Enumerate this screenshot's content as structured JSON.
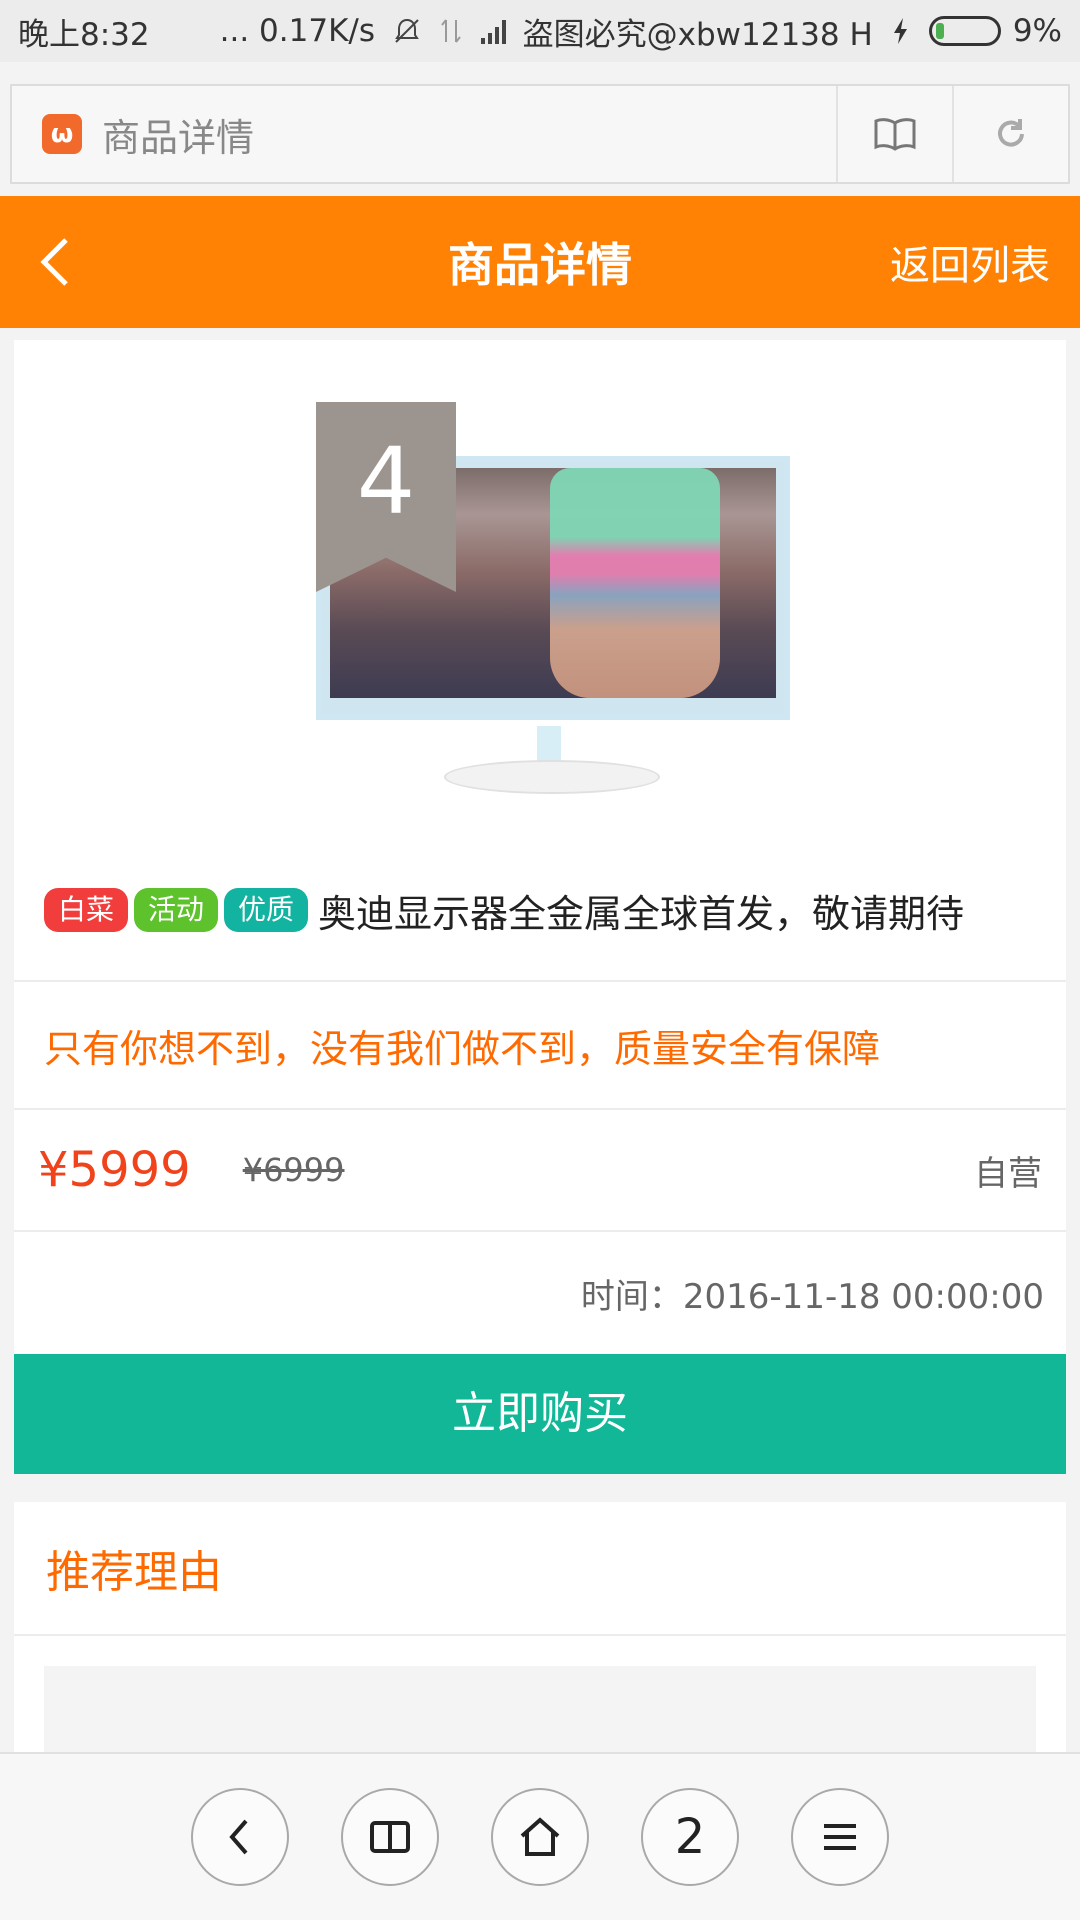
{
  "status_bar": {
    "time": "晚上8:32",
    "network_speed": "... 0.17K/s",
    "carrier_text": "盗图必究@xbw12138 H",
    "battery": "9%",
    "icons": [
      "mute-bell-icon",
      "data-arrows-icon",
      "signal-icon",
      "charging-icon",
      "battery-icon"
    ]
  },
  "browser": {
    "page_title": "商品详情",
    "favicon": "site-icon"
  },
  "header": {
    "title": "商品详情",
    "right_link": "返回列表",
    "bg_color": "#ff8205"
  },
  "product": {
    "rank_badge": "4",
    "tags": [
      {
        "label": "白菜",
        "color": "#f23d3d"
      },
      {
        "label": "活动",
        "color": "#5ec22c"
      },
      {
        "label": "优质",
        "color": "#12b3a1"
      }
    ],
    "title": "奥迪显示器全金属全球首发，敬请期待",
    "slogan": "只有你想不到，没有我们做不到，质量安全有保障",
    "price_now": "¥5999",
    "price_old": "¥6999",
    "seller_type": "自营",
    "time_label": "时间：2016-11-18 00:00:00",
    "buy_button": "立即购买"
  },
  "recommend": {
    "title": "推荐理由"
  },
  "toolbar": {
    "tabs_count": "2",
    "buttons": [
      "back-icon",
      "bookmarks-icon",
      "home-icon",
      "tabs-counter",
      "menu-icon"
    ]
  }
}
